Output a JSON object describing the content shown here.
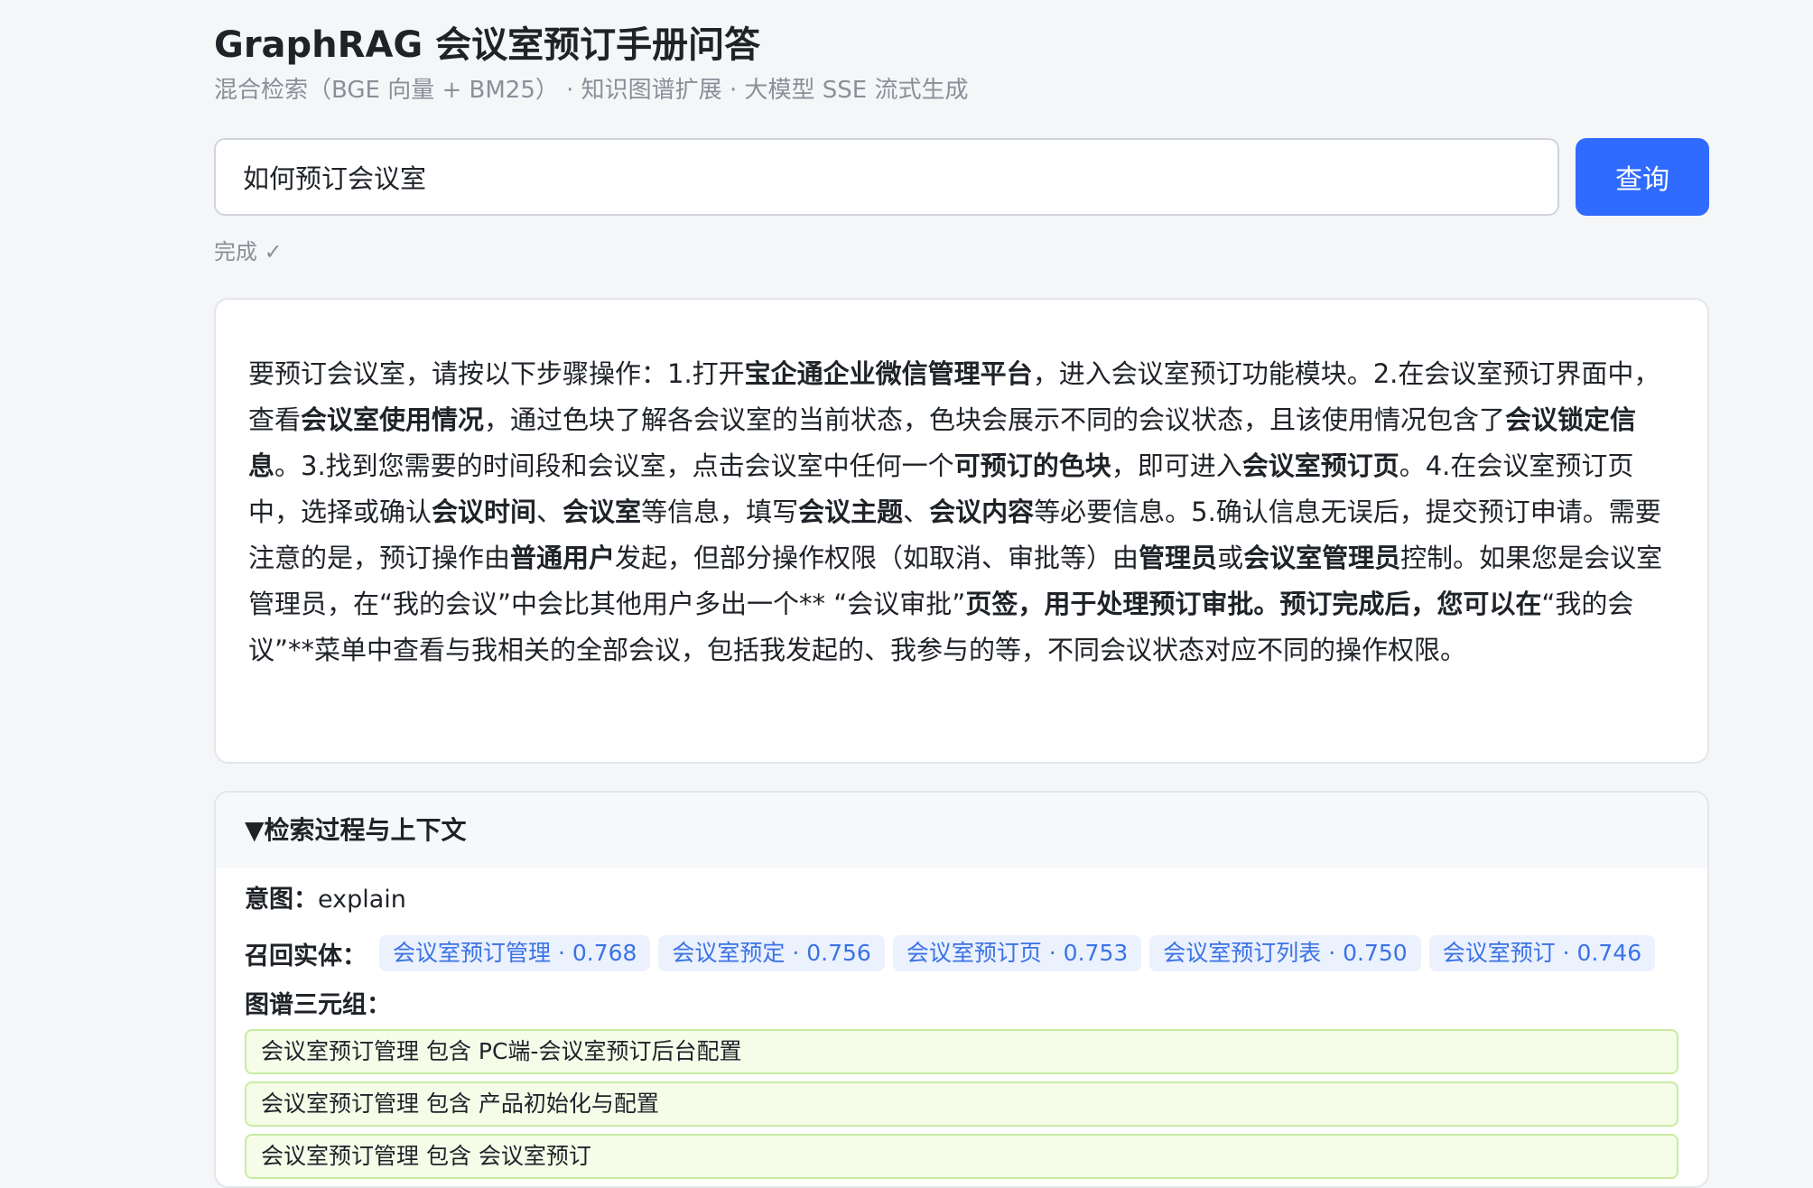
{
  "header": {
    "title": "GraphRAG 会议室预订手册问答",
    "subtitle": "混合检索（BGE 向量 + BM25） · 知识图谱扩展 · 大模型 SSE 流式生成"
  },
  "search": {
    "value": "如何预订会议室",
    "button_label": "查询"
  },
  "status": "完成 ✓",
  "answer": {
    "segments": [
      {
        "t": "要预订会议室，请按以下步骤操作：1.打开",
        "b": false
      },
      {
        "t": "宝企通企业微信管理平台",
        "b": true
      },
      {
        "t": "，进入会议室预订功能模块。2.在会议室预订界面中，查看",
        "b": false
      },
      {
        "t": "会议室使用情况",
        "b": true
      },
      {
        "t": "，通过色块了解各会议室的当前状态，色块会展示不同的会议状态，且该使用情况包含了",
        "b": false
      },
      {
        "t": "会议锁定信息",
        "b": true
      },
      {
        "t": "。3.找到您需要的时间段和会议室，点击会议室中任何一个",
        "b": false
      },
      {
        "t": "可预订的色块",
        "b": true
      },
      {
        "t": "，即可进入",
        "b": false
      },
      {
        "t": "会议室预订页",
        "b": true
      },
      {
        "t": "。4.在会议室预订页中，选择或确认",
        "b": false
      },
      {
        "t": "会议时间",
        "b": true
      },
      {
        "t": "、",
        "b": false
      },
      {
        "t": "会议室",
        "b": true
      },
      {
        "t": "等信息，填写",
        "b": false
      },
      {
        "t": "会议主题",
        "b": true
      },
      {
        "t": "、",
        "b": false
      },
      {
        "t": "会议内容",
        "b": true
      },
      {
        "t": "等必要信息。5.确认信息无误后，提交预订申请。需要注意的是，预订操作由",
        "b": false
      },
      {
        "t": "普通用户",
        "b": true
      },
      {
        "t": "发起，但部分操作权限（如取消、审批等）由",
        "b": false
      },
      {
        "t": "管理员",
        "b": true
      },
      {
        "t": "或",
        "b": false
      },
      {
        "t": "会议室管理员",
        "b": true
      },
      {
        "t": "控制。如果您是会议室管理员，在“我的会议”中会比其他用户多出一个** “会议审批”",
        "b": false
      },
      {
        "t": "页签，用于处理预订审批。预订完成后，您可以在",
        "b": true
      },
      {
        "t": "“我的会议”**菜单中查看与我相关的全部会议，包括我发起的、我参与的等，不同会议状态对应不同的操作权限。",
        "b": false
      }
    ]
  },
  "details": {
    "summary": "▼检索过程与上下文",
    "intent_label": "意图：",
    "intent_value": "explain",
    "entities_label": "召回实体：",
    "entities": [
      "会议室预订管理 · 0.768",
      "会议室预定 · 0.756",
      "会议室预订页 · 0.753",
      "会议室预订列表 · 0.750",
      "会议室预订 · 0.746"
    ],
    "triples_label": "图谱三元组：",
    "triples": [
      "会议室预订管理 包含 PC端-会议室预订后台配置",
      "会议室预订管理 包含 产品初始化与配置",
      "会议室预订管理 包含 会议室预订"
    ]
  }
}
